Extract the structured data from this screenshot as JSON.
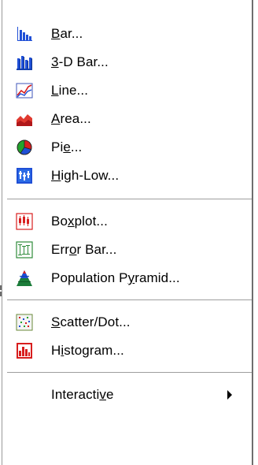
{
  "menu": {
    "items": [
      {
        "label": "Bar...",
        "accel": "B",
        "icon": "bar-chart-icon"
      },
      {
        "label": "3-D Bar...",
        "accel": "3",
        "icon": "3d-bar-chart-icon"
      },
      {
        "label": "Line...",
        "accel": "L",
        "icon": "line-chart-icon"
      },
      {
        "label": "Area...",
        "accel": "A",
        "icon": "area-chart-icon"
      },
      {
        "label": "Pie...",
        "accel": "e",
        "icon": "pie-chart-icon"
      },
      {
        "label": "High-Low...",
        "accel": "H",
        "icon": "high-low-chart-icon"
      },
      {
        "label": "Boxplot...",
        "accel": "x",
        "icon": "boxplot-icon"
      },
      {
        "label": "Error Bar...",
        "accel": "o",
        "icon": "error-bar-icon"
      },
      {
        "label": "Population Pyramid...",
        "accel": "y",
        "icon": "population-pyramid-icon"
      },
      {
        "label": "Scatter/Dot...",
        "accel": "S",
        "icon": "scatter-dot-icon"
      },
      {
        "label": "Histogram...",
        "accel": "i",
        "icon": "histogram-icon"
      },
      {
        "label": "Interactive",
        "accel": "v",
        "icon": "submenu-arrow-icon"
      }
    ]
  },
  "colors": {
    "bar_blue": "#1f4fd6",
    "line_red": "#d81e1e",
    "area_red": "#e0392f",
    "pie_green": "#23a32d",
    "pyramid_green": "#1b7d3a",
    "separator": "#9e9e9e"
  }
}
